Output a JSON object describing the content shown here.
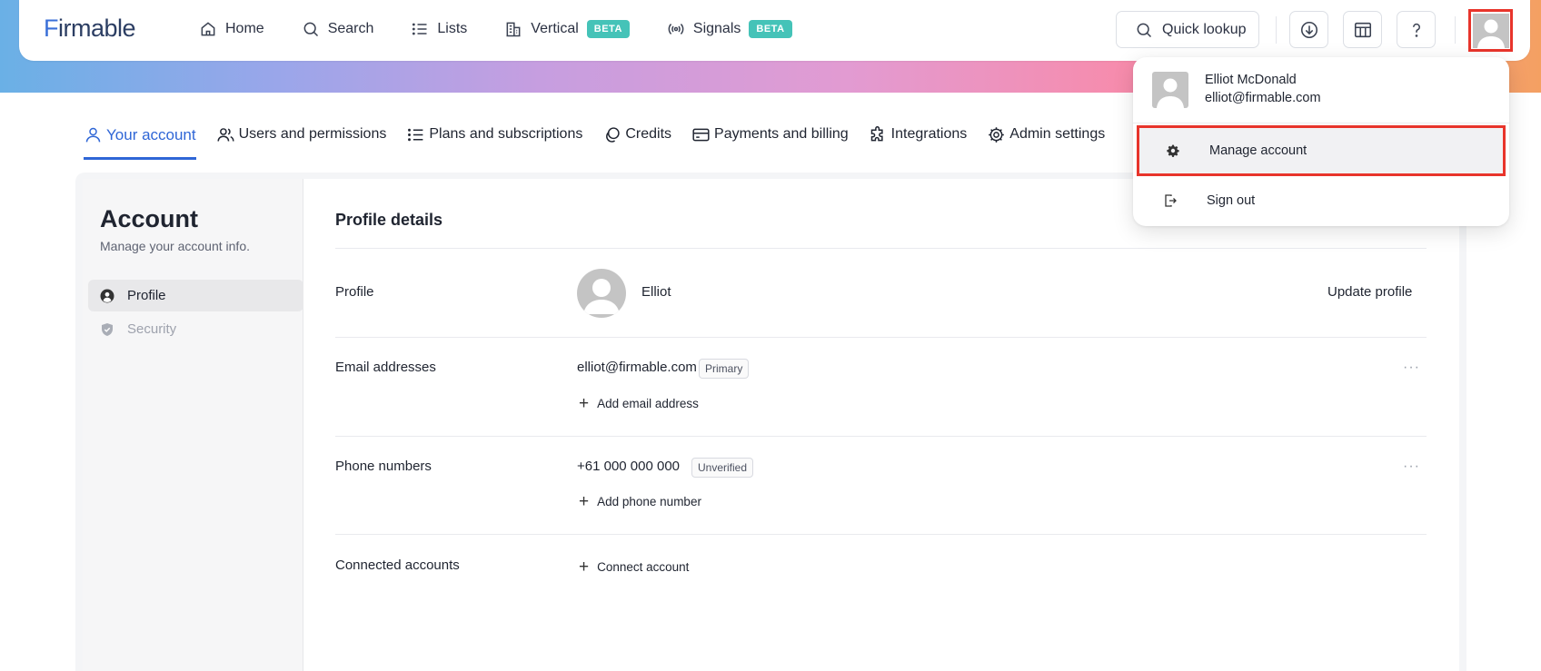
{
  "app": {
    "brand": "Firmable"
  },
  "nav": {
    "items": [
      {
        "label": "Home",
        "icon": "home-icon"
      },
      {
        "label": "Search",
        "icon": "search-icon"
      },
      {
        "label": "Lists",
        "icon": "list-icon"
      },
      {
        "label": "Vertical",
        "icon": "building-icon",
        "badge": "BETA"
      },
      {
        "label": "Signals",
        "icon": "signal-icon",
        "badge": "BETA"
      }
    ],
    "quick_lookup": "Quick lookup"
  },
  "tabs": [
    {
      "label": "Your account",
      "active": true
    },
    {
      "label": "Users and permissions"
    },
    {
      "label": "Plans and subscriptions"
    },
    {
      "label": "Credits"
    },
    {
      "label": "Payments and billing"
    },
    {
      "label": "Integrations"
    },
    {
      "label": "Admin settings"
    }
  ],
  "sidebar": {
    "title": "Account",
    "subtitle": "Manage your account info.",
    "items": [
      {
        "label": "Profile",
        "active": true
      },
      {
        "label": "Security"
      }
    ]
  },
  "profile": {
    "heading": "Profile details",
    "profile_label": "Profile",
    "first_name": "Elliot",
    "update_link": "Update profile",
    "email_label": "Email addresses",
    "email": "elliot@firmable.com",
    "email_tag": "Primary",
    "add_email": "Add email address",
    "phone_label": "Phone numbers",
    "phone": "+61 000 000 000",
    "phone_tag": "Unverified",
    "add_phone": "Add phone number",
    "connected_label": "Connected accounts",
    "connect": "Connect account",
    "more_menu": "···"
  },
  "dropdown": {
    "name": "Elliot McDonald",
    "email": "elliot@firmable.com",
    "manage": "Manage account",
    "signout": "Sign out"
  },
  "colors": {
    "accent": "#2f66d6",
    "beta": "#45c3b8",
    "highlight": "#e8342b"
  }
}
